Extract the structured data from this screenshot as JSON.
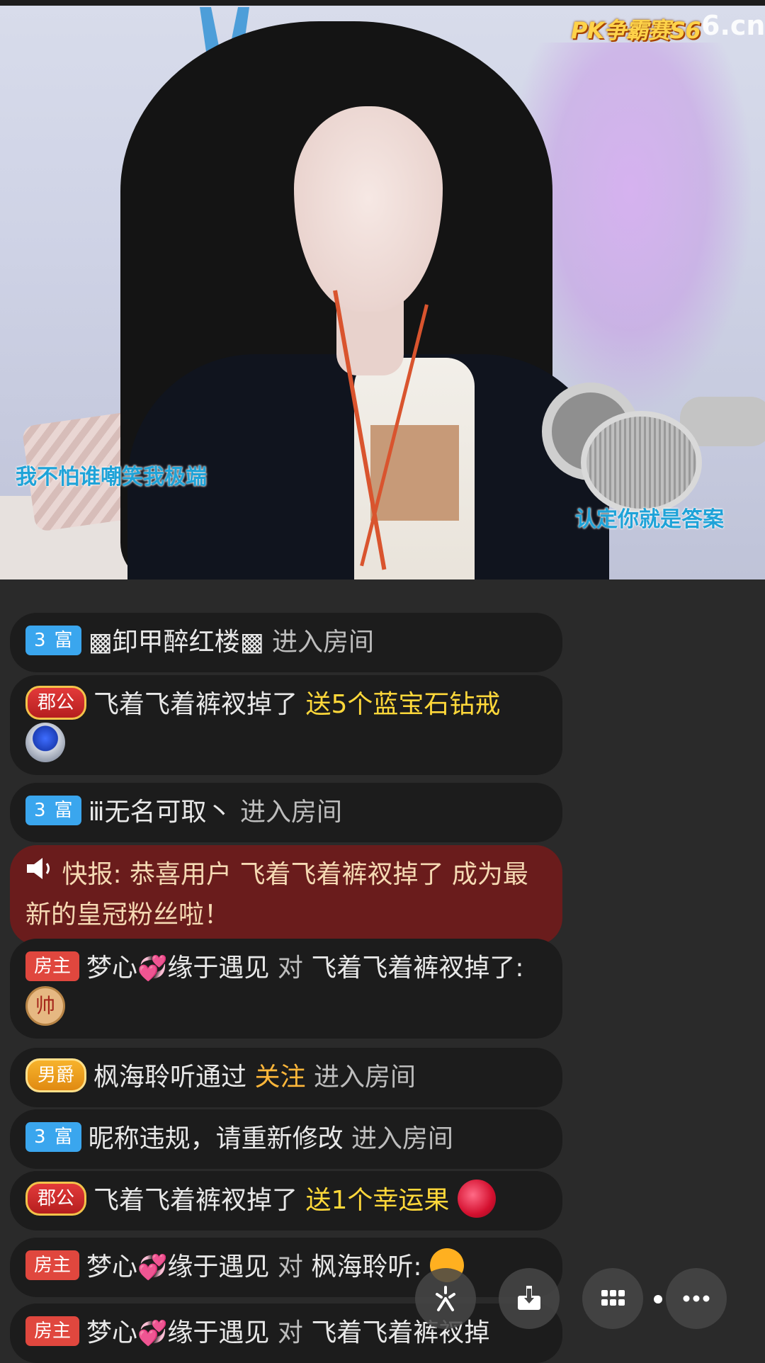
{
  "stream": {
    "logo_event": "PK争霸赛S6",
    "logo_site": "6.cn",
    "lyric_left": "我不怕谁嘲笑我极端",
    "lyric_right": "认定你就是答案"
  },
  "chat": {
    "messages": [
      {
        "badge": "富",
        "badge_level": "3",
        "user": "▩卸甲醉红楼▩",
        "action": "进入房间"
      },
      {
        "badge": "郡公",
        "user": "飞着飞着裤衩掉了",
        "gift_text": "送5个蓝宝石钻戒",
        "gift_icon": "sapphire-ring-icon"
      },
      {
        "badge": "富",
        "badge_level": "3",
        "user": "ⅲ无名可取丶",
        "action": "进入房间"
      },
      {
        "type": "alert",
        "prefix": "快报:",
        "text": "恭喜用户 飞着飞着裤衩掉了 成为最新的皇冠粉丝啦！"
      },
      {
        "badge": "房主",
        "user": "梦心",
        "user_suffix": "缘于遇见",
        "to_word": "对",
        "target": "飞着飞着裤衩掉了:",
        "sticker": "帅"
      },
      {
        "badge": "男爵",
        "user": "枫海聆听通过",
        "highlight": "关注",
        "action": "进入房间"
      },
      {
        "badge": "富",
        "badge_level": "3",
        "user": "昵称违规，请重新修改",
        "action": "进入房间"
      },
      {
        "badge": "郡公",
        "user": "飞着飞着裤衩掉了",
        "gift_text": "送1个幸运果",
        "gift_icon": "lucky-fruit-icon"
      },
      {
        "badge": "房主",
        "user": "梦心",
        "user_suffix": "缘于遇见",
        "to_word": "对",
        "target": "枫海聆听:"
      },
      {
        "badge": "房主",
        "user": "梦心",
        "user_suffix": "缘于遇见",
        "to_word": "对",
        "target": "飞着飞着裤衩掉"
      }
    ]
  },
  "controls": [
    {
      "name": "sparkle-icon"
    },
    {
      "name": "download-icon"
    },
    {
      "name": "grid-icon"
    },
    {
      "name": "more-icon"
    }
  ],
  "colors": {
    "background": "#2a2a2a",
    "bubble": "#1c1c1c",
    "alert_bubble": "#6a1c1c",
    "gift_text": "#ffd83a",
    "follow_text": "#ffb73a",
    "fu_badge": "#3aa6ee",
    "host_badge": "#e0473e"
  }
}
